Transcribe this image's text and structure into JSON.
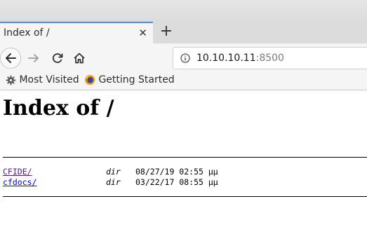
{
  "browser": {
    "tab_title": "Index of /",
    "url_host": "10.10.10.11",
    "url_port": ":8500",
    "bookmarks": [
      "Most Visited",
      "Getting Started"
    ]
  },
  "page": {
    "heading": "Index of /",
    "entries": [
      {
        "name": "CFIDE/",
        "type": "dir",
        "modified": "08/27/19 02:55 μμ"
      },
      {
        "name": "cfdocs/",
        "type": "dir",
        "modified": "03/22/17 08:55 μμ"
      }
    ]
  }
}
